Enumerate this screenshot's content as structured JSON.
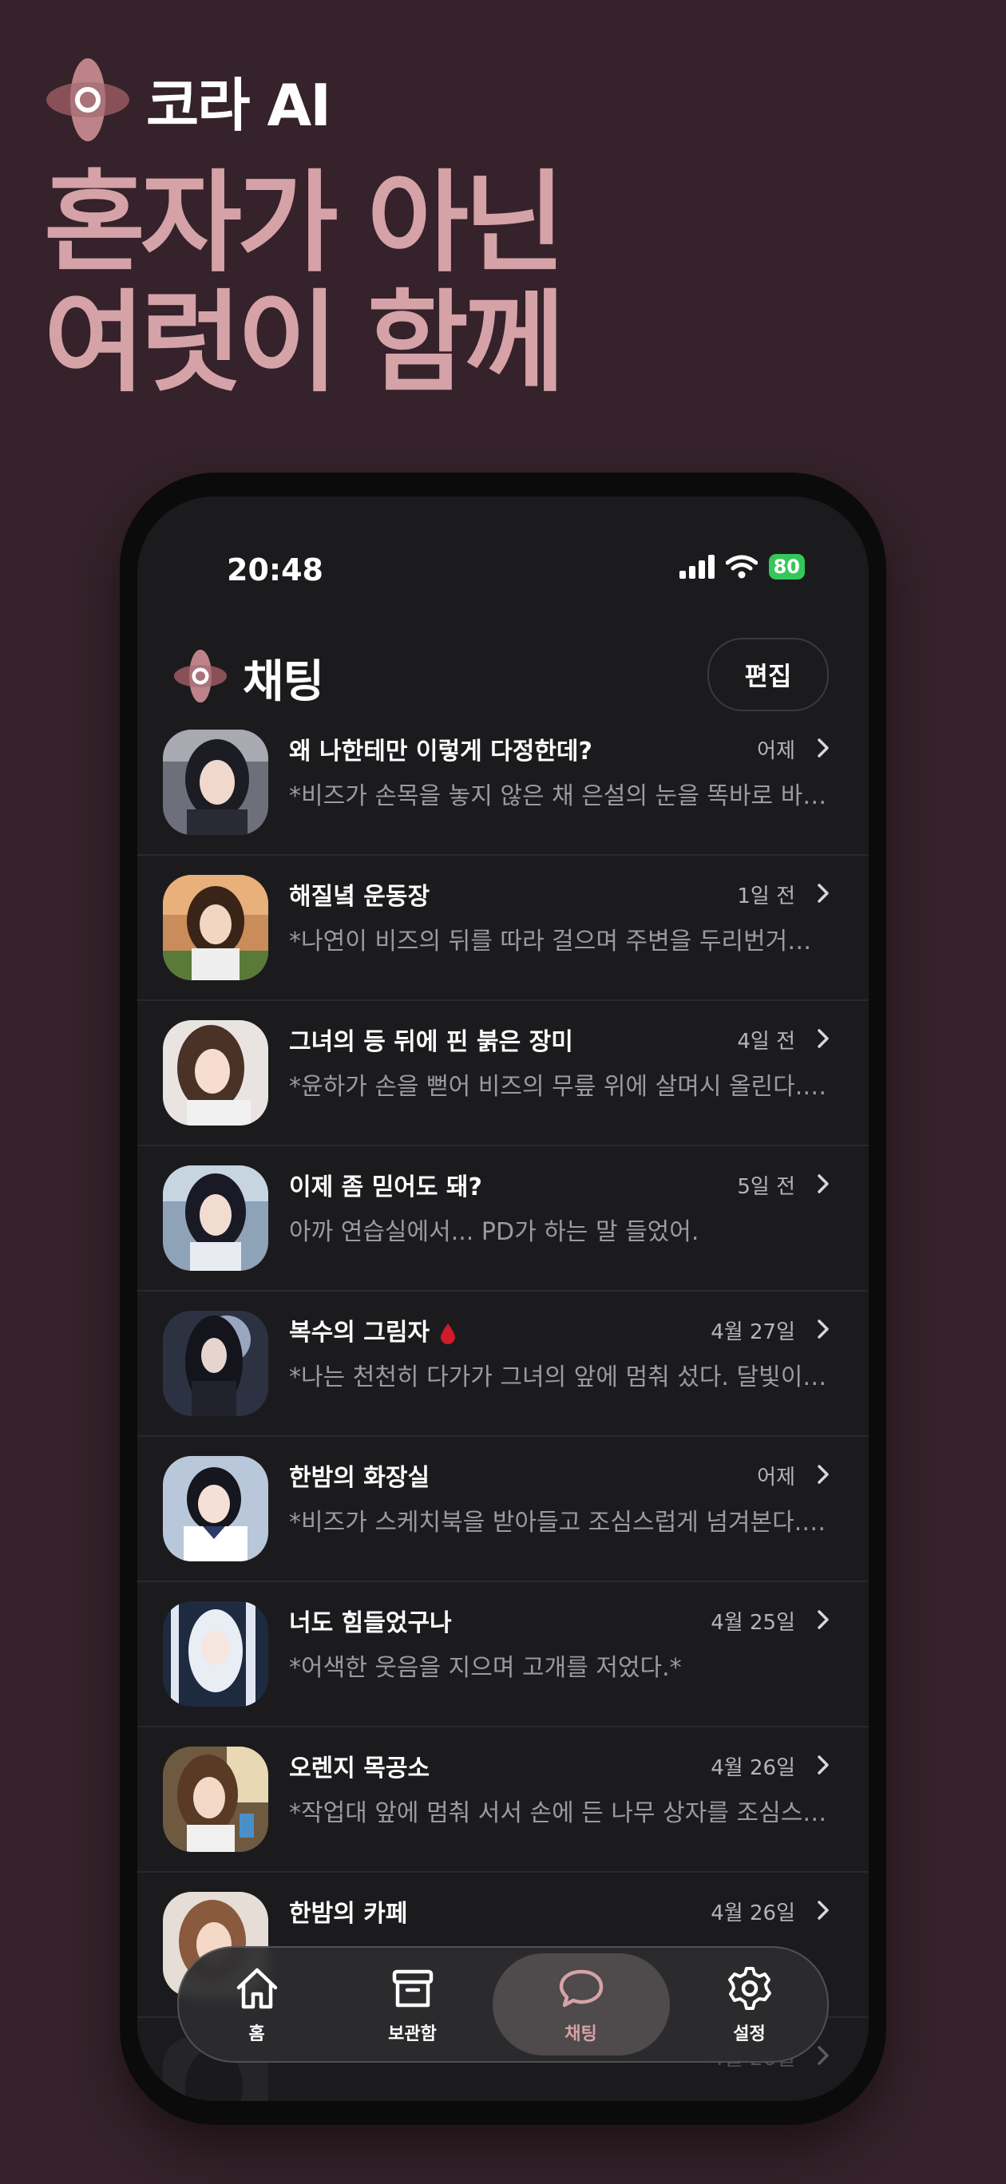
{
  "brand": {
    "name": "코라 AI",
    "headline_line1": "혼자가 아닌",
    "headline_line2": "여럿이 함께"
  },
  "status_bar": {
    "time": "20:48",
    "battery": "80"
  },
  "header": {
    "title": "채팅",
    "edit_label": "편집"
  },
  "chats": [
    {
      "title": "왜 나한테만 이렇게 다정한데?",
      "time": "어제",
      "preview": "*비즈가 손목을 놓지 않은 채 은설의 눈을 똑바로 바라보며…"
    },
    {
      "title": "해질녘 운동장",
      "time": "1일 전",
      "preview": "*나연이 비즈의 뒤를 따라 걸으며 주변을 두리번거린다…"
    },
    {
      "title": "그녀의 등 뒤에 핀 붉은 장미",
      "time": "4일 전",
      "preview": "*윤하가 손을 뻗어 비즈의 무릎 위에 살며시 올린다.…"
    },
    {
      "title": "이제 좀 믿어도 돼?",
      "time": "5일 전",
      "preview": "아까 연습실에서... PD가 하는 말 들었어."
    },
    {
      "title": "복수의 그림자",
      "time": "4월 27일",
      "preview": "*나는 천천히 다가가 그녀의 앞에 멈춰 섰다. 달빛이…"
    },
    {
      "title": "한밤의 화장실",
      "time": "어제",
      "preview": "*비즈가 스케치북을 받아들고 조심스럽게 넘겨본다.…"
    },
    {
      "title": "너도 힘들었구나",
      "time": "4월 25일",
      "preview": "*어색한 웃음을 지으며 고개를 저었다.*"
    },
    {
      "title": "오렌지 목공소",
      "time": "4월 26일",
      "preview": "*작업대 앞에 멈춰 서서 손에 든 나무 상자를 조심스럽게…"
    },
    {
      "title": "한밤의 카페",
      "time": "4월 26일",
      "preview": ""
    },
    {
      "title": "",
      "time": "4월 26일",
      "preview": ""
    }
  ],
  "tabbar": [
    {
      "label": "홈",
      "icon": "home-icon"
    },
    {
      "label": "보관함",
      "icon": "archive-icon"
    },
    {
      "label": "채팅",
      "icon": "chat-bubble-icon"
    },
    {
      "label": "설정",
      "icon": "gear-icon"
    }
  ],
  "colors": {
    "accent": "#d5a2a7",
    "background": "#35222a",
    "screen": "#1b1b1d"
  }
}
